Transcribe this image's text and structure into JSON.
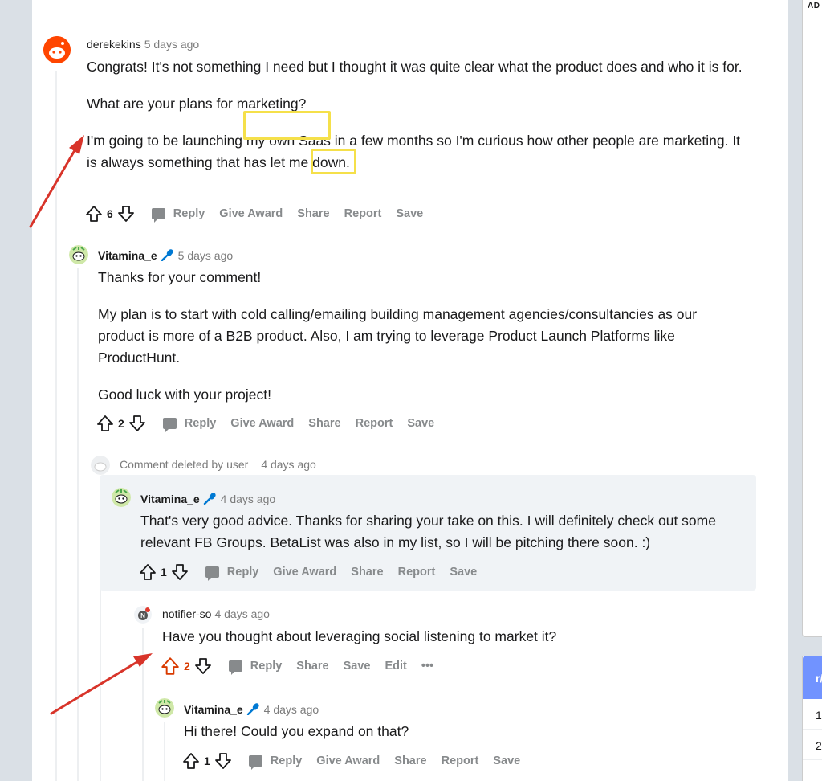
{
  "sidebar": {
    "ad_label": "AD",
    "card_header": "r/",
    "rows": [
      "1",
      "2"
    ]
  },
  "comments": [
    {
      "user": "derekekins",
      "time": "5 days ago",
      "paragraphs": [
        "Congrats! It's not something I need but I thought it was quite clear what the product does and who it is for.",
        "What are your plans for marketing?",
        "I'm going to be launching my own Saas in a few months so I'm curious how other people are marketing. It is always something that has let me down."
      ],
      "votes": "6",
      "actions": [
        "Reply",
        "Give Award",
        "Share",
        "Report",
        "Save"
      ]
    },
    {
      "user": "Vitamina_e",
      "time": "5 days ago",
      "paragraphs": [
        "Thanks for your comment!",
        "My plan is to start with cold calling/emailing building management agencies/consultancies as our product is more of a B2B product. Also, I am trying to leverage Product Launch Platforms like ProductHunt.",
        "Good luck with your project!"
      ],
      "votes": "2",
      "actions": [
        "Reply",
        "Give Award",
        "Share",
        "Report",
        "Save"
      ]
    },
    {
      "deleted_text": "Comment deleted by user",
      "time": "4 days ago"
    },
    {
      "user": "Vitamina_e",
      "time": "4 days ago",
      "paragraphs": [
        "That's very good advice. Thanks for sharing your take on this. I will definitely check out some relevant FB Groups. BetaList was also in my list, so I will be pitching there soon. :)"
      ],
      "votes": "1",
      "actions": [
        "Reply",
        "Give Award",
        "Share",
        "Report",
        "Save"
      ]
    },
    {
      "user": "notifier-so",
      "time": "4 days ago",
      "paragraphs": [
        "Have you thought about leveraging social listening to market it?"
      ],
      "votes": "2",
      "actions": [
        "Reply",
        "Share",
        "Save",
        "Edit",
        "•••"
      ]
    },
    {
      "user": "Vitamina_e",
      "time": "4 days ago",
      "paragraphs": [
        "Hi there! Could you expand on that?"
      ],
      "votes": "1",
      "actions": [
        "Reply",
        "Give Award",
        "Share",
        "Report",
        "Save"
      ]
    }
  ],
  "colors": {
    "annotation_arrow": "#d8342a",
    "highlight_box": "#f5e04a",
    "upvoted": "#d93a00"
  },
  "icons": [
    "upvote-icon",
    "downvote-icon",
    "reply-icon",
    "mic-icon",
    "avatar-icon"
  ]
}
